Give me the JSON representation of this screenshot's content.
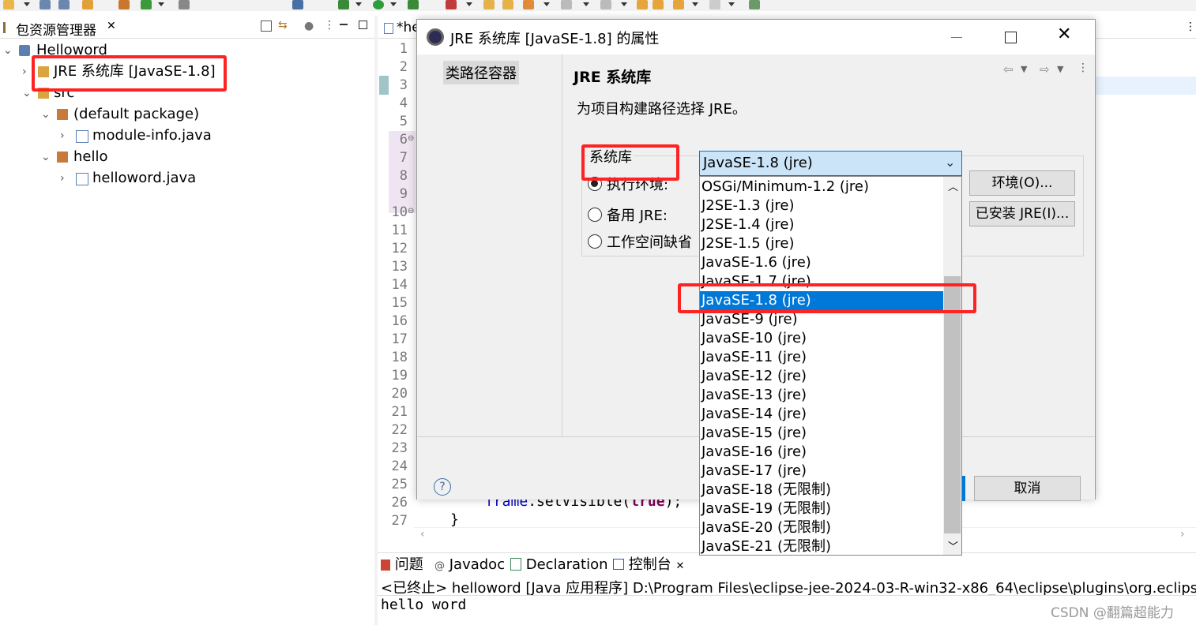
{
  "explorer": {
    "tab_label": "包资源管理器",
    "tab_close": "✕",
    "tree": [
      {
        "label": "Helloword"
      },
      {
        "label": "JRE 系统库 [JavaSE-1.8]"
      },
      {
        "label": "src"
      },
      {
        "label": "(default package)"
      },
      {
        "label": "module-info.java"
      },
      {
        "label": "hello"
      },
      {
        "label": "helloword.java"
      }
    ]
  },
  "editor": {
    "tab_label": "*he",
    "line_numbers": [
      "1",
      "2",
      "3",
      "4",
      "5",
      "6",
      "7",
      "8",
      "9",
      "10",
      "11",
      "12",
      "13",
      "14",
      "15",
      "16",
      "17",
      "18",
      "19",
      "20",
      "21",
      "22",
      "23",
      "24",
      "25",
      "26",
      "27"
    ],
    "code_line_26": {
      "obj": "frame",
      "call": ".setVisible(",
      "kw": "true",
      "end": ");"
    },
    "code_line_27": "}"
  },
  "dialog": {
    "title": "JRE 系统库 [JavaSE-1.8] 的属性",
    "left_item": "类路径容器",
    "section_title": "JRE 系统库",
    "description": "为项目构建路径选择 JRE。",
    "group_label": "系统库",
    "radio_exec_env": "执行环境:",
    "radio_alt_jre": "备用 JRE:",
    "radio_workspace": "工作空间缺省",
    "combo_value": "JavaSE-1.8  (jre)",
    "btn_environments": "环境(O)...",
    "btn_installed_jres": "已安装 JRE(I)...",
    "btn_cancel": "取消",
    "help": "?",
    "dropdown_options": [
      "OSGi/Minimum-1.2  (jre)",
      "J2SE-1.3  (jre)",
      "J2SE-1.4  (jre)",
      "J2SE-1.5  (jre)",
      "JavaSE-1.6  (jre)",
      "JavaSE-1.7  (jre)",
      "JavaSE-1.8  (jre)",
      "JavaSE-9  (jre)",
      "JavaSE-10  (jre)",
      "JavaSE-11  (jre)",
      "JavaSE-12  (jre)",
      "JavaSE-13  (jre)",
      "JavaSE-14  (jre)",
      "JavaSE-15  (jre)",
      "JavaSE-16  (jre)",
      "JavaSE-17  (jre)",
      "JavaSE-18  (无限制)",
      "JavaSE-19  (无限制)",
      "JavaSE-20  (无限制)",
      "JavaSE-21  (无限制)"
    ],
    "selected_option": "JavaSE-1.8  (jre)"
  },
  "console": {
    "tabs": [
      "问题",
      "Javadoc",
      "Declaration",
      "控制台"
    ],
    "status_line": "<已终止> helloword [Java 应用程序] D:\\Program Files\\eclipse-jee-2024-03-R-win32-x86_64\\eclipse\\plugins\\org.eclipse.ju",
    "output": "hello word"
  },
  "watermark": "CSDN @翻篇超能力",
  "colors": {
    "highlight": "#f22222",
    "selection": "#0078d7"
  }
}
